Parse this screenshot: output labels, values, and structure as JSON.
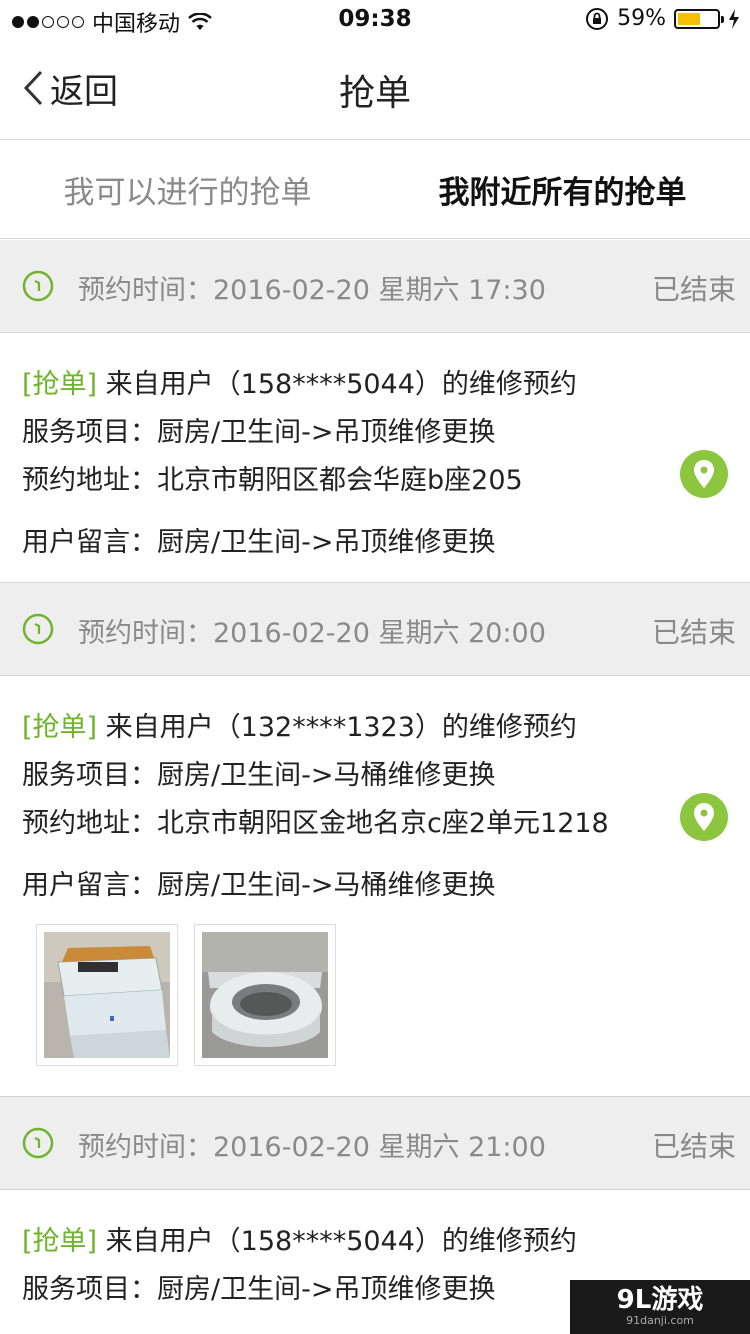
{
  "status_bar": {
    "carrier": "中国移动",
    "time": "09:38",
    "battery_percent": "59%",
    "signal_dots_filled": 2,
    "signal_dots_total": 5
  },
  "nav": {
    "back_label": "返回",
    "title": "抢单"
  },
  "tabs": [
    {
      "label": "我可以进行的抢单",
      "active": false
    },
    {
      "label": "我附近所有的抢单",
      "active": true
    }
  ],
  "orders": [
    {
      "time_label": "预约时间：2016-02-20 星期六 17:30",
      "status": "已结束",
      "tag": "[抢单]",
      "title": " 来自用户（158****5044）的维修预约",
      "service": "服务项目：厨房/卫生间->吊顶维修更换",
      "address": "预约地址：北京市朝阳区都会华庭b座205",
      "message": "用户留言：厨房/卫生间->吊顶维修更换",
      "has_photos": false
    },
    {
      "time_label": "预约时间：2016-02-20 星期六 20:00",
      "status": "已结束",
      "tag": "[抢单]",
      "title": " 来自用户（132****1323）的维修预约",
      "service": "服务项目：厨房/卫生间->马桶维修更换",
      "address": "预约地址：北京市朝阳区金地名京c座2单元1218",
      "message": "用户留言：厨房/卫生间->马桶维修更换",
      "has_photos": true
    },
    {
      "time_label": "预约时间：2016-02-20 星期六 21:00",
      "status": "已结束",
      "tag": "[抢单]",
      "title": " 来自用户（158****5044）的维修预约",
      "service": "服务项目：厨房/卫生间->吊顶维修更换"
    }
  ],
  "watermark": {
    "logo": "9L游戏",
    "url": "91danji.com"
  },
  "colors": {
    "accent_green": "#6fb52c",
    "pin_green": "#8cc63e",
    "battery_yellow": "#f6c000",
    "header_gray": "#eeeeee"
  }
}
